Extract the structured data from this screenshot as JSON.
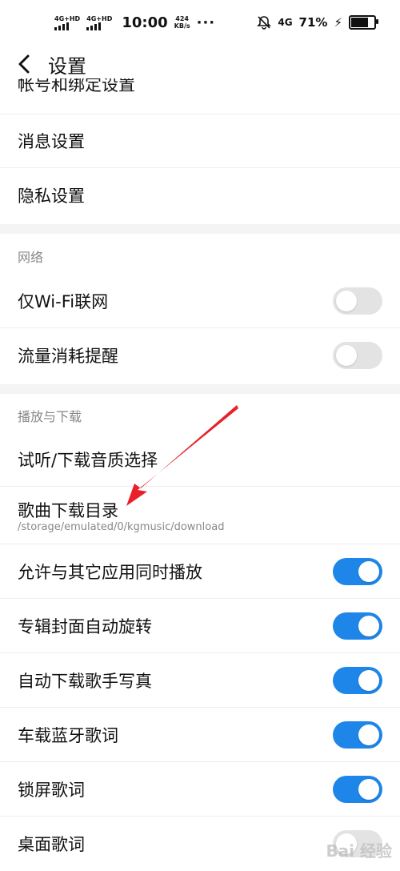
{
  "status_bar": {
    "signal1_tag": "4G+HD",
    "signal2_tag": "4G+HD",
    "time": "10:00",
    "speed_value": "424",
    "speed_unit": "KB/s",
    "more": "···",
    "network": "4G",
    "battery_percent": "71%",
    "battery_level": 0.71
  },
  "header": {
    "back_icon": "chevron-left-icon",
    "title": "设置"
  },
  "partial_row": {
    "label": "帐号和绑定设置"
  },
  "rows_top": [
    {
      "label": "消息设置"
    },
    {
      "label": "隐私设置"
    }
  ],
  "network_section": {
    "header": "网络",
    "items": [
      {
        "label": "仅Wi-Fi联网",
        "toggle": false
      },
      {
        "label": "流量消耗提醒",
        "toggle": false
      }
    ]
  },
  "play_section": {
    "header": "播放与下载",
    "quality": {
      "label": "试听/下载音质选择"
    },
    "download_dir": {
      "label": "歌曲下载目录",
      "path": "/storage/emulated/0/kgmusic/download"
    },
    "items": [
      {
        "label": "允许与其它应用同时播放",
        "toggle": true
      },
      {
        "label": "专辑封面自动旋转",
        "toggle": true
      },
      {
        "label": "自动下载歌手写真",
        "toggle": true
      },
      {
        "label": "车载蓝牙歌词",
        "toggle": true
      },
      {
        "label": "锁屏歌词",
        "toggle": true
      },
      {
        "label": "桌面歌词",
        "toggle": false
      }
    ]
  },
  "colors": {
    "toggle_on": "#1e86e8",
    "toggle_off": "#e3e3e3",
    "annotation_arrow": "#e8202a"
  },
  "watermark": "Bai 经验"
}
